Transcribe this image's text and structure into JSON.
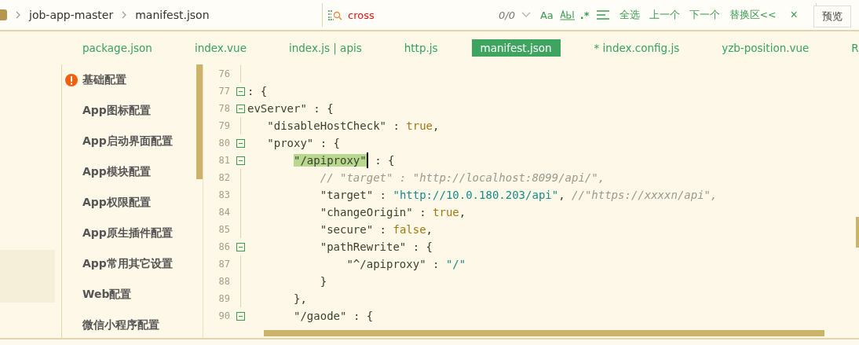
{
  "breadcrumb": [
    "job-app-master",
    "manifest.json"
  ],
  "find": {
    "value": "cross",
    "count": "0/0",
    "case_label": "Aa",
    "regex_label": ".*",
    "actions": [
      "全选",
      "上一个",
      "下一个",
      "替换区<<"
    ],
    "close": "×"
  },
  "preview_button": "预览",
  "tabs": [
    {
      "label": "package.json",
      "selected": false
    },
    {
      "label": "index.vue",
      "selected": false
    },
    {
      "label": "index.js | apis",
      "selected": false
    },
    {
      "label": "http.js",
      "selected": false
    },
    {
      "label": "manifest.json",
      "selected": true
    },
    {
      "label": "* index.config.js",
      "selected": false
    },
    {
      "label": "yzb-position.vue",
      "selected": false
    },
    {
      "label": "R",
      "selected": false
    }
  ],
  "sidebar": {
    "items": [
      {
        "label": "基础配置",
        "warning": true
      },
      {
        "label": "App图标配置",
        "warning": false
      },
      {
        "label": "App启动界面配置",
        "warning": false
      },
      {
        "label": "App模块配置",
        "warning": false
      },
      {
        "label": "App权限配置",
        "warning": false
      },
      {
        "label": "App原生插件配置",
        "warning": false
      },
      {
        "label": "App常用其它设置",
        "warning": false
      },
      {
        "label": "Web配置",
        "warning": false
      },
      {
        "label": "微信小程序配置",
        "warning": false
      }
    ]
  },
  "code": {
    "lines": [
      {
        "number": "76",
        "fold": false
      },
      {
        "number": "77",
        "fold": true,
        "tokens": [
          {
            "kind": "punc",
            "text": ": {"
          }
        ]
      },
      {
        "number": "78",
        "fold": true,
        "tokens": [
          {
            "kind": "key",
            "text": "evServer\""
          },
          {
            "kind": "punc",
            "text": " : {"
          }
        ]
      },
      {
        "number": "79",
        "fold": false,
        "tokens": [
          {
            "kind": "key",
            "text": "   \"disableHostCheck\""
          },
          {
            "kind": "punc",
            "text": " : "
          },
          {
            "kind": "bool",
            "text": "true"
          },
          {
            "kind": "punc",
            "text": ","
          }
        ]
      },
      {
        "number": "80",
        "fold": true,
        "tokens": [
          {
            "kind": "key",
            "text": "   \"proxy\""
          },
          {
            "kind": "punc",
            "text": " : {"
          }
        ]
      },
      {
        "number": "81",
        "fold": true,
        "tokens": [
          {
            "kind": "match",
            "text": "       \"/apiproxy\""
          },
          {
            "kind": "punc",
            "text": " : {"
          }
        ]
      },
      {
        "number": "82",
        "fold": false,
        "tokens": [
          {
            "kind": "comment",
            "text": "           // \"target\" : \"http://localhost:8099/api/\","
          }
        ]
      },
      {
        "number": "83",
        "fold": false,
        "tokens": [
          {
            "kind": "key",
            "text": "           \"target\""
          },
          {
            "kind": "punc",
            "text": " : "
          },
          {
            "kind": "string",
            "text": "\"http://10.0.180.203/api\""
          },
          {
            "kind": "punc",
            "text": ", "
          },
          {
            "kind": "comment",
            "text": "//\"https://xxxxn/api\","
          }
        ]
      },
      {
        "number": "84",
        "fold": false,
        "tokens": [
          {
            "kind": "key",
            "text": "           \"changeOrigin\""
          },
          {
            "kind": "punc",
            "text": " : "
          },
          {
            "kind": "bool",
            "text": "true"
          },
          {
            "kind": "punc",
            "text": ","
          }
        ]
      },
      {
        "number": "85",
        "fold": false,
        "tokens": [
          {
            "kind": "key",
            "text": "           \"secure\""
          },
          {
            "kind": "punc",
            "text": " : "
          },
          {
            "kind": "bool",
            "text": "false"
          },
          {
            "kind": "punc",
            "text": ","
          }
        ]
      },
      {
        "number": "86",
        "fold": true,
        "tokens": [
          {
            "kind": "key",
            "text": "           \"pathRewrite\""
          },
          {
            "kind": "punc",
            "text": " : {"
          }
        ]
      },
      {
        "number": "87",
        "fold": false,
        "tokens": [
          {
            "kind": "key",
            "text": "               \"^/apiproxy\""
          },
          {
            "kind": "punc",
            "text": " : "
          },
          {
            "kind": "string",
            "text": "\"/\""
          }
        ]
      },
      {
        "number": "88",
        "fold": false,
        "tokens": [
          {
            "kind": "punc",
            "text": "           }"
          }
        ]
      },
      {
        "number": "89",
        "fold": false,
        "tokens": [
          {
            "kind": "punc",
            "text": "       },"
          }
        ]
      },
      {
        "number": "90",
        "fold": true,
        "tokens": [
          {
            "kind": "key",
            "text": "       \"/gaode\""
          },
          {
            "kind": "punc",
            "text": " : {"
          }
        ]
      }
    ]
  }
}
